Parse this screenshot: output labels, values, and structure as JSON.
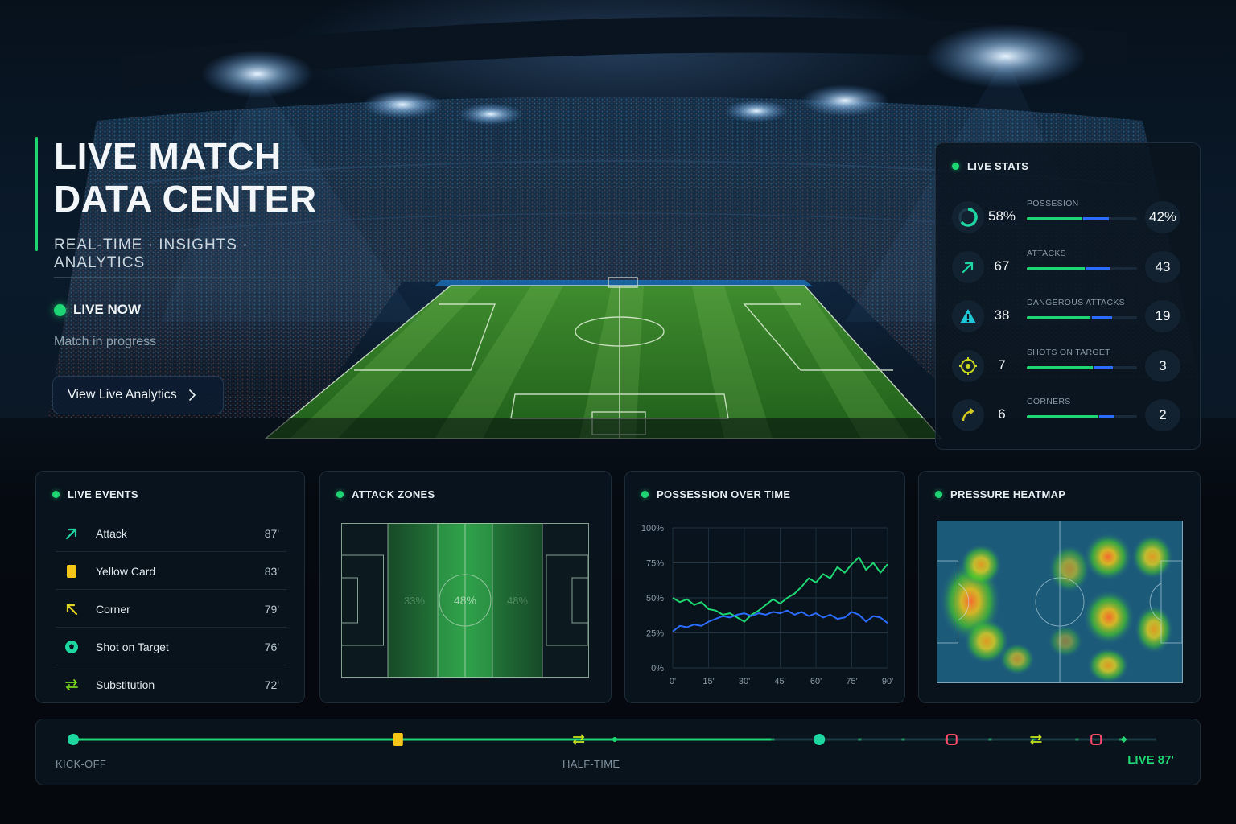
{
  "hero": {
    "title_line1": "LIVE MATCH",
    "title_line2": "DATA CENTER",
    "subtitle": "REAL-TIME · INSIGHTS · ANALYTICS",
    "live_label": "LIVE NOW",
    "status": "Match in progress",
    "cta_label": "View Live Analytics"
  },
  "colors": {
    "accent_green": "#1ed673",
    "accent_blue": "#2b6cff",
    "card_yellow": "#f5c518",
    "alert_red": "#ff4d6d"
  },
  "live_stats": {
    "title": "LIVE STATS",
    "rows": [
      {
        "label": "POSSESION",
        "left": "58%",
        "right": "42%",
        "left_share": 0.58,
        "icon": "possession-ring-icon"
      },
      {
        "label": "ATTACKS",
        "left": "67",
        "right": "43",
        "left_share": 0.61,
        "icon": "arrow-up-right-icon"
      },
      {
        "label": "DANGEROUS ATTACKS",
        "left": "38",
        "right": "19",
        "left_share": 0.67,
        "icon": "warning-triangle-icon"
      },
      {
        "label": "SHOTS ON TARGET",
        "left": "7",
        "right": "3",
        "left_share": 0.7,
        "icon": "crosshair-icon"
      },
      {
        "label": "CORNERS",
        "left": "6",
        "right": "2",
        "left_share": 0.75,
        "icon": "corner-flag-icon"
      }
    ]
  },
  "live_events": {
    "title": "LIVE EVENTS",
    "items": [
      {
        "name": "Attack",
        "minute": "87'",
        "icon": "arrow-up-right-icon"
      },
      {
        "name": "Yellow Card",
        "minute": "83'",
        "icon": "yellow-card-icon"
      },
      {
        "name": "Corner",
        "minute": "79'",
        "icon": "corner-arrow-icon"
      },
      {
        "name": "Shot on Target",
        "minute": "76'",
        "icon": "ball-icon"
      },
      {
        "name": "Substitution",
        "minute": "72'",
        "icon": "swap-icon"
      }
    ]
  },
  "attack_zones": {
    "title": "ATTACK ZONES",
    "zones": [
      {
        "label": "33%"
      },
      {
        "label": "48%"
      },
      {
        "label": "48%"
      }
    ]
  },
  "possession_over_time": {
    "title": "POSSESSION OVER TIME"
  },
  "pressure_heatmap": {
    "title": "PRESSURE HEATMAP"
  },
  "timeline": {
    "start_label": "KICK-OFF",
    "half_label": "HALF-TIME",
    "live_label": "LIVE 87'",
    "progress": 0.97,
    "events": [
      {
        "minute": 0,
        "icon": "ball-icon"
      },
      {
        "minute": 27,
        "icon": "yellow-card-icon"
      },
      {
        "minute": 42,
        "icon": "swap-icon"
      },
      {
        "minute": 62,
        "icon": "ball-icon"
      },
      {
        "minute": 73,
        "icon": "red-alert-icon"
      },
      {
        "minute": 80,
        "icon": "swap-icon"
      },
      {
        "minute": 85,
        "icon": "red-alert-icon"
      }
    ]
  },
  "chart_data": {
    "type": "line",
    "title": "POSSESSION OVER TIME",
    "xlabel": "",
    "ylabel": "",
    "xlim": [
      0,
      90
    ],
    "ylim": [
      0,
      100
    ],
    "x_ticks": [
      "0'",
      "15'",
      "30'",
      "45'",
      "60'",
      "75'",
      "90'"
    ],
    "y_ticks": [
      "0%",
      "25%",
      "50%",
      "75%",
      "100%"
    ],
    "grid": true,
    "series": [
      {
        "color": "#1ed673",
        "x": [
          0,
          3,
          6,
          9,
          12,
          15,
          18,
          21,
          24,
          27,
          30,
          33,
          36,
          39,
          42,
          45,
          48,
          51,
          54,
          57,
          60,
          63,
          66,
          69,
          72,
          75,
          78,
          81,
          84,
          87,
          90
        ],
        "y": [
          50,
          47,
          49,
          45,
          47,
          42,
          41,
          38,
          39,
          36,
          33,
          38,
          41,
          45,
          49,
          46,
          50,
          53,
          58,
          64,
          61,
          67,
          64,
          72,
          68,
          74,
          79,
          70,
          75,
          68,
          74
        ]
      },
      {
        "color": "#2b6cff",
        "x": [
          0,
          3,
          6,
          9,
          12,
          15,
          18,
          21,
          24,
          27,
          30,
          33,
          36,
          39,
          42,
          45,
          48,
          51,
          54,
          57,
          60,
          63,
          66,
          69,
          72,
          75,
          78,
          81,
          84,
          87,
          90
        ],
        "y": [
          26,
          30,
          29,
          31,
          30,
          33,
          35,
          37,
          36,
          38,
          39,
          37,
          39,
          38,
          40,
          39,
          41,
          38,
          40,
          37,
          39,
          36,
          38,
          35,
          36,
          40,
          38,
          33,
          37,
          36,
          32
        ]
      }
    ]
  }
}
